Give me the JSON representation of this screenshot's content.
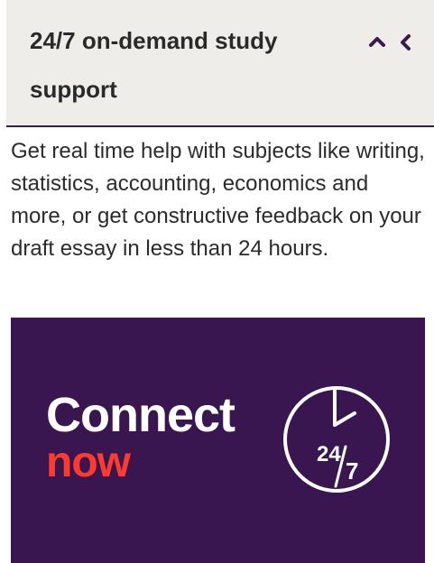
{
  "accordion": {
    "title": "24/7 on-demand study support",
    "toggle_icons": [
      "chevron-up-icon",
      "chevron-left-icon"
    ],
    "expanded": true,
    "body_text": "Get real time help with subjects like writing, statistics, accounting, economics and more, or get constructive feedback on your draft essay in less than 24 hours."
  },
  "banner": {
    "headline": "Connect",
    "subheadline": "now",
    "clock_hours": "24",
    "clock_days": "7",
    "icon": "clock-icon"
  },
  "colors": {
    "header_background": "#efedea",
    "header_border": "#3b1a4f",
    "banner_background": "#3a1650",
    "banner_text": "#ffffff",
    "banner_accent": "#ff3b2f",
    "chevron": "#3b1a4f"
  }
}
